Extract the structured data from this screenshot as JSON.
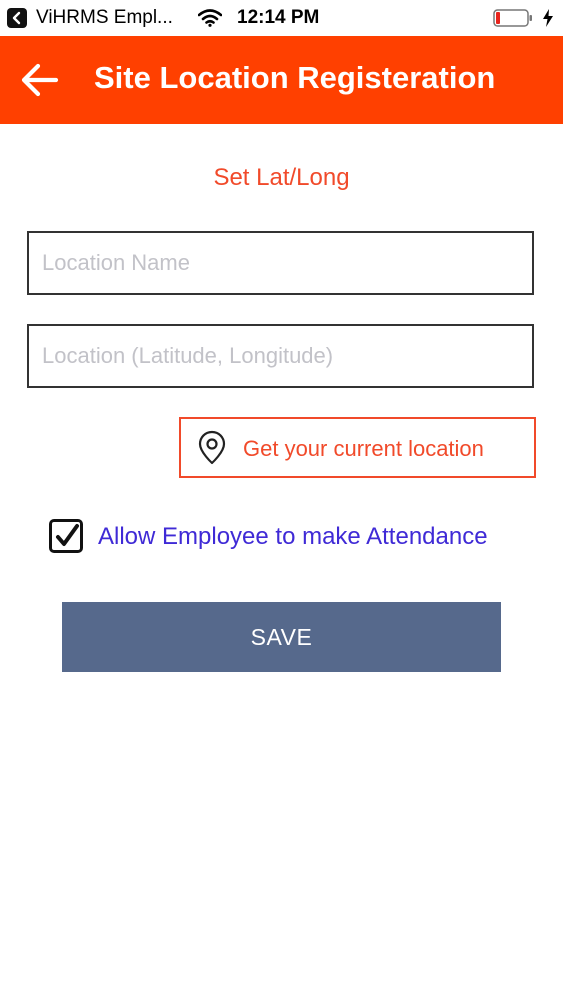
{
  "status_bar": {
    "back_app_icon": "chevron-left-icon",
    "app_name": "ViHRMS Empl...",
    "wifi_icon": "wifi-icon",
    "time": "12:14 PM",
    "battery_icon": "battery-low-icon",
    "charging_icon": "bolt-icon"
  },
  "header": {
    "back_icon": "arrow-left-icon",
    "title": "Site Location Registeration",
    "color": "#ff4000"
  },
  "form": {
    "section_title": "Set Lat/Long",
    "location_name": {
      "value": "",
      "placeholder": "Location Name"
    },
    "location_coords": {
      "value": "",
      "placeholder": "Location (Latitude, Longitude)"
    },
    "get_location": {
      "label": "Get your current location",
      "icon": "map-pin-icon"
    },
    "allow_attendance": {
      "label": "Allow Employee to make Attendance",
      "checked": true
    },
    "save_label": "SAVE"
  },
  "colors": {
    "accent": "#f14a2a",
    "checkbox_label": "#3f2ad6",
    "save_button": "#56698c"
  }
}
